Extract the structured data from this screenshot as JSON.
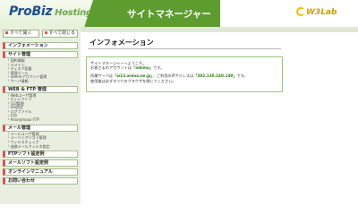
{
  "header": {
    "logo_main": "ProBiz",
    "logo_sub": "Hosting",
    "title": "サイトマネージャー",
    "brand": "W3Lab"
  },
  "sidebar": {
    "open_all": "すべて開く",
    "close_all": "すべて閉じる",
    "sections": [
      {
        "label": "インフォメーション",
        "items": []
      },
      {
        "label": "サイト管理",
        "items": [
          "契約情報",
          "ドメイン",
          "ディスク容量",
          "管理ツール",
          "adminアカウント管理",
          "サーバ情報"
        ]
      },
      {
        "label": "WEB & FTP 管理",
        "items": [
          "Webユーザ管理",
          "ディレクトリ",
          "CGI管理",
          "SSI設定",
          "ログファイル",
          "FTP",
          "Anonymous FTP"
        ]
      },
      {
        "label": "メール管理",
        "items": [
          "メールユーザ管理",
          "メーリングリスト管理",
          "ウィルスチェック",
          "迷惑メールフィルタ設定"
        ]
      },
      {
        "label": "FTPソフト設定例",
        "items": []
      },
      {
        "label": "メールソフト設定例",
        "items": []
      },
      {
        "label": "オンラインマニュアル",
        "items": []
      },
      {
        "label": "お問い合わせ",
        "items": []
      }
    ]
  },
  "main": {
    "page_title": "インフォメーション",
    "welcome": "サイトマネージャーへようこそ。",
    "account_prefix": "お客さまのアカウントは",
    "account_name": "「adsmu」",
    "account_suffix": "です。",
    "server_prefix": "所属サーバは",
    "server_name": "「w13.arena.ne.jp」",
    "server_mid": "、ご利用のIPアドレスは",
    "ip_address": "「202.130.140.149」",
    "server_suffix": "です。",
    "note": "使用後は必ずすべてのブラウザを閉じてください。"
  }
}
